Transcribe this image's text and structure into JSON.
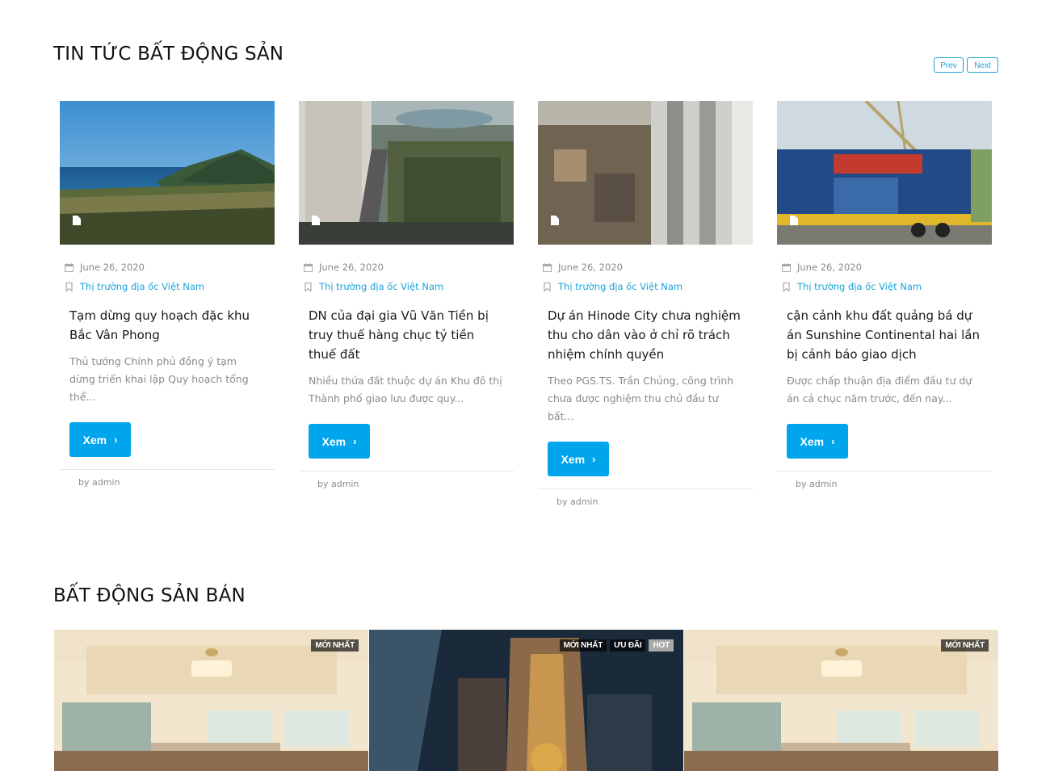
{
  "news": {
    "title": "TIN TỨC BẤT ĐỘNG SẢN",
    "prev_label": "Prev",
    "next_label": "Next",
    "articles": [
      {
        "date": "June 26, 2020",
        "category": "Thị trường địa ốc Việt Nam",
        "title": "Tạm dừng quy hoạch đặc khu Bắc Vân Phong",
        "excerpt": "Thủ tướng Chính phủ đồng ý tạm dừng triển khai lập Quy hoạch tổng thể...",
        "button": "Xem",
        "author": "by admin"
      },
      {
        "date": "June 26, 2020",
        "category": "Thị trường địa ốc Việt Nam",
        "title": "DN của đại gia Vũ Văn Tiền bị truy thuế hàng chục tỷ tiền thuế đất",
        "excerpt": "Nhiều thửa đất thuộc dự án Khu đô thị Thành phố giao lưu được quy...",
        "button": "Xem",
        "author": "by admin"
      },
      {
        "date": "June 26, 2020",
        "category": "Thị trường địa ốc Việt Nam",
        "title": "Dự án Hinode City chưa nghiệm thu cho dân vào ở chỉ rõ trách nhiệm chính quyền",
        "excerpt": "Theo PGS.TS. Trần Chủng, công trình chưa được nghiệm thu chủ đầu tư bất...",
        "button": "Xem",
        "author": "by admin"
      },
      {
        "date": "June 26, 2020",
        "category": "Thị trường địa ốc Việt Nam",
        "title": "cận cảnh khu đất quảng bá dự án Sunshine Continental hai lần bị cảnh báo giao dịch",
        "excerpt": "Được chấp thuận địa điểm đầu tư dự án cả chục năm trước, đến nay...",
        "button": "Xem",
        "author": "by admin"
      }
    ]
  },
  "sale": {
    "title": "BẤT ĐỘNG SẢN BÁN",
    "listings": [
      {
        "badges": [
          "MỚI NHẤT"
        ]
      },
      {
        "badges": [
          "MỚI NHẤT",
          "ƯU ĐÃI",
          "HOT"
        ]
      },
      {
        "badges": [
          "MỚI NHẤT"
        ]
      }
    ]
  },
  "icons": {
    "calendar": "calendar-icon",
    "bookmark": "bookmark-icon",
    "document": "document-icon",
    "chevron": "chevron-right-icon"
  },
  "colors": {
    "accent": "#00a5ec",
    "link": "#1ba3d9",
    "muted": "#8a8a8a"
  }
}
